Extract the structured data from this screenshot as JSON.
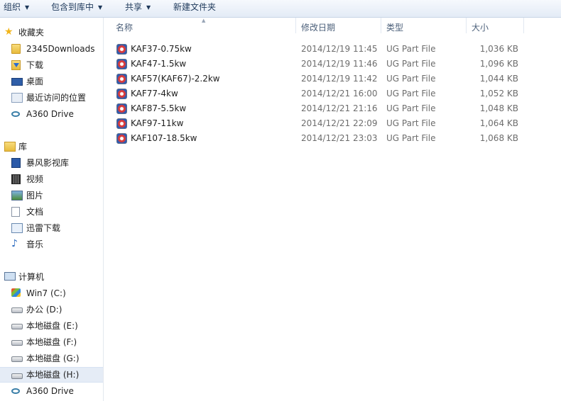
{
  "toolbar": {
    "organize": "组织",
    "include_in_library": "包含到库中",
    "share": "共享",
    "new_folder": "新建文件夹"
  },
  "nav": {
    "favorites": "收藏夹",
    "fav_items": [
      "2345Downloads",
      "下载",
      "桌面",
      "最近访问的位置",
      "A360 Drive"
    ],
    "libraries": "库",
    "lib_items": [
      "暴风影视库",
      "视频",
      "图片",
      "文档",
      "迅雷下载",
      "音乐"
    ],
    "computer": "计算机",
    "drives": [
      "Win7 (C:)",
      "办公 (D:)",
      "本地磁盘 (E:)",
      "本地磁盘 (F:)",
      "本地磁盘 (G:)",
      "本地磁盘 (H:)",
      "A360 Drive"
    ],
    "selected": "本地磁盘 (H:)"
  },
  "columns": {
    "name": "名称",
    "date": "修改日期",
    "type": "类型",
    "size": "大小"
  },
  "files": [
    {
      "name": "KAF37-0.75kw",
      "date": "2014/12/19 11:45",
      "type": "UG Part File",
      "size": "1,036 KB"
    },
    {
      "name": "KAF47-1.5kw",
      "date": "2014/12/19 11:46",
      "type": "UG Part File",
      "size": "1,096 KB"
    },
    {
      "name": "KAF57(KAF67)-2.2kw",
      "date": "2014/12/19 11:42",
      "type": "UG Part File",
      "size": "1,044 KB"
    },
    {
      "name": "KAF77-4kw",
      "date": "2014/12/21 16:00",
      "type": "UG Part File",
      "size": "1,052 KB"
    },
    {
      "name": "KAF87-5.5kw",
      "date": "2014/12/21 21:16",
      "type": "UG Part File",
      "size": "1,048 KB"
    },
    {
      "name": "KAF97-11kw",
      "date": "2014/12/21 22:09",
      "type": "UG Part File",
      "size": "1,064 KB"
    },
    {
      "name": "KAF107-18.5kw",
      "date": "2014/12/21 23:03",
      "type": "UG Part File",
      "size": "1,068 KB"
    }
  ]
}
